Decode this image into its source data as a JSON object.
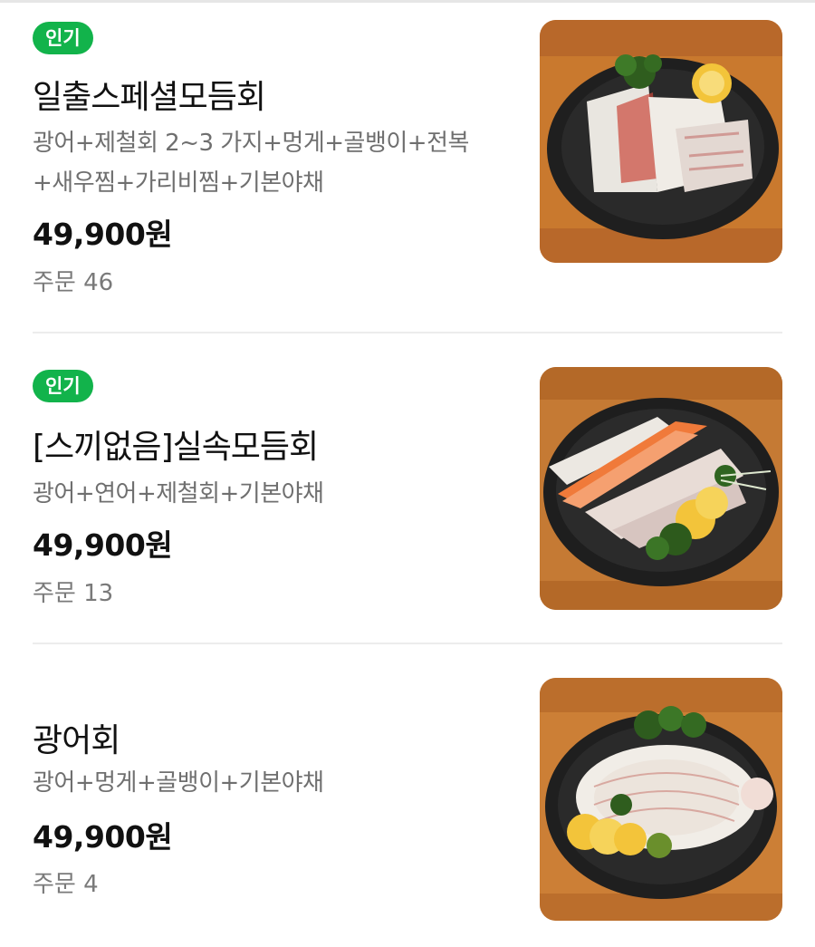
{
  "menu": {
    "items": [
      {
        "badge": "인기",
        "name": "일출스페셜모듬회",
        "desc_line1": "광어+제철회 2~3 가지+멍게+골뱅이+전복",
        "desc_line2": "+새우찜+가리비찜+기본야채",
        "price": "49,900원",
        "orders": "주문 46",
        "image_icon": "sashimi-platter-photo"
      },
      {
        "badge": "인기",
        "name": "[스끼없음]실속모듬회",
        "desc_line1": "광어+연어+제철회+기본야채",
        "price": "49,900원",
        "orders": "주문 13",
        "image_icon": "sashimi-salmon-photo"
      },
      {
        "name": "광어회",
        "desc_line1": "광어+멍게+골뱅이+기본야채",
        "price": "49,900원",
        "orders": "주문 4",
        "image_icon": "flatfish-sashimi-photo"
      }
    ]
  },
  "colors": {
    "badge_green": "#12b34b",
    "text_primary": "#111111",
    "text_secondary": "#6f6f6f",
    "divider": "#ececec"
  }
}
